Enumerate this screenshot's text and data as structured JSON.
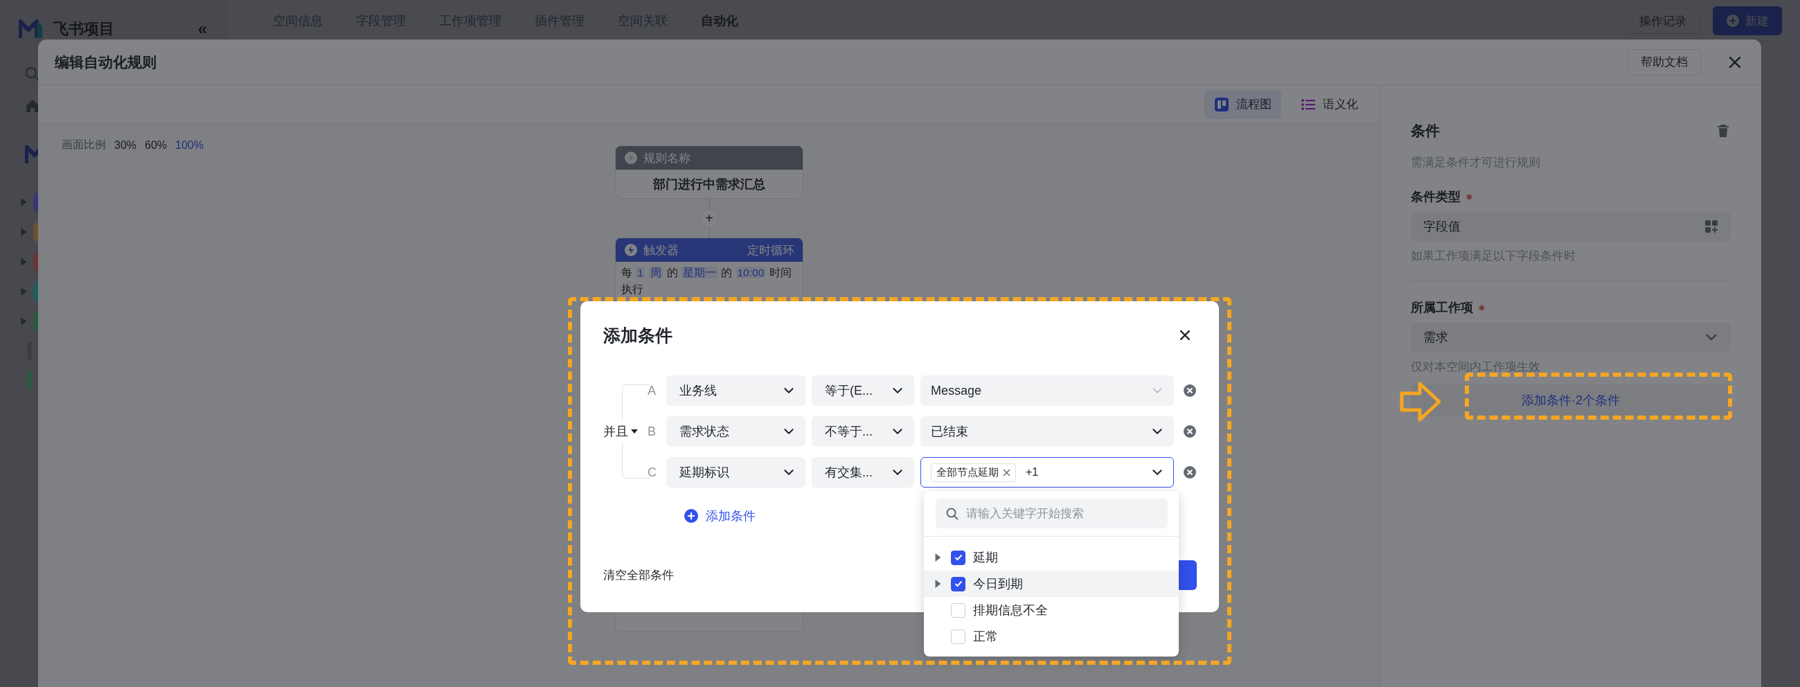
{
  "sidebar": {
    "app_name": "飞书项目",
    "collapse": "«",
    "spaces": [
      {
        "kind": "group",
        "color": "#3a3578"
      },
      {
        "kind": "group",
        "color": "#6b5230"
      },
      {
        "kind": "group",
        "color": "#6a3535"
      },
      {
        "kind": "group",
        "color": "#1e5e5e"
      },
      {
        "kind": "group",
        "color": "#2a5a40"
      },
      {
        "kind": "item",
        "color": "#3c3c42"
      },
      {
        "kind": "item",
        "color": "#2a5a40"
      }
    ]
  },
  "nav_tabs": [
    {
      "label": "空间信息",
      "selected": false
    },
    {
      "label": "字段管理",
      "selected": false
    },
    {
      "label": "工作项管理",
      "selected": false
    },
    {
      "label": "插件管理",
      "selected": false
    },
    {
      "label": "空间关联",
      "selected": false
    },
    {
      "label": "自动化",
      "selected": true
    }
  ],
  "actions": {
    "history": "操作记录",
    "create": "新建"
  },
  "drawer": {
    "title": "编辑自动化规则",
    "help": "帮助文档",
    "views": [
      {
        "kind": "flow",
        "label": "流程图",
        "selected": true
      },
      {
        "kind": "list",
        "label": "语义化",
        "selected": false
      }
    ],
    "zoom": {
      "label": "画面比例",
      "options": [
        {
          "label": "30%",
          "selected": false
        },
        {
          "label": "60%",
          "selected": false
        },
        {
          "label": "100%",
          "selected": true
        }
      ]
    },
    "flow": {
      "name_node": {
        "title": "规则名称",
        "value": "部门进行中需求汇总"
      },
      "add": "+",
      "trigger_node": {
        "title": "触发器",
        "type": "定时循环",
        "parts": [
          {
            "kind": "plain",
            "text": "每"
          },
          {
            "kind": "token",
            "text": "1"
          },
          {
            "kind": "token",
            "text": "周"
          },
          {
            "kind": "plain",
            "text": "的"
          },
          {
            "kind": "token",
            "text": "星期一"
          },
          {
            "kind": "plain",
            "text": "的"
          },
          {
            "kind": "token",
            "text": "10:00"
          },
          {
            "kind": "plain",
            "text": "时间"
          },
          {
            "kind": "plain",
            "text": "执行"
          }
        ]
      }
    },
    "panel": {
      "title": "条件",
      "description": "需满足条件才可进行规则",
      "fields": [
        {
          "kind": "picker",
          "label": "条件类型",
          "required": true,
          "value": "字段值",
          "hint": "如果工作项满足以下字段条件时"
        },
        {
          "kind": "select",
          "label": "所属工作项",
          "required": true,
          "value": "需求",
          "hint": "仅对本空间内工作项生效"
        }
      ],
      "add_button": "添加条件·2个条件"
    }
  },
  "dialog": {
    "title": "添加条件",
    "logic": "并且",
    "conditions": [
      {
        "letter": "A",
        "field": "业务线",
        "operator": "等于(E...",
        "value": {
          "kind": "input",
          "text": "Message"
        }
      },
      {
        "letter": "B",
        "field": "需求状态",
        "operator": "不等于...",
        "value": {
          "kind": "select",
          "text": "已结束"
        }
      },
      {
        "letter": "C",
        "field": "延期标识",
        "operator": "有交集...",
        "value": {
          "kind": "tags",
          "tags": [
            "全部节点延期"
          ],
          "more": "+1",
          "focused": true
        }
      }
    ],
    "add_condition": "添加条件",
    "clear": "清空全部条件",
    "dropdown": {
      "placeholder": "请输入关键字开始搜索",
      "options": [
        {
          "kind": "group",
          "label": "延期",
          "checked": true,
          "hovered": false
        },
        {
          "kind": "group",
          "label": "今日到期",
          "checked": true,
          "hovered": true
        },
        {
          "kind": "leaf",
          "label": "排期信息不全",
          "checked": false,
          "hovered": false
        },
        {
          "kind": "leaf",
          "label": "正常",
          "checked": false,
          "hovered": false
        }
      ]
    }
  }
}
